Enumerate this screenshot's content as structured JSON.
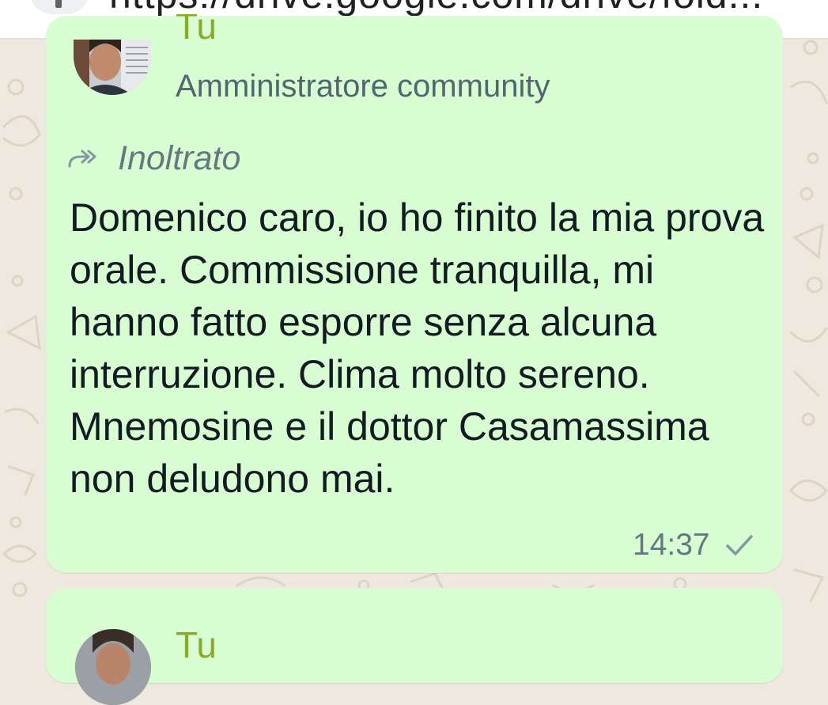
{
  "top_bar": {
    "url_text": "https://drive.google.com/drive/fold..."
  },
  "message": {
    "sender": "Tu",
    "role": "Amministratore community",
    "forwarded_label": "Inoltrato",
    "text": "Domenico caro, io ho finito la mia prova orale. Commissione tranquilla, mi hanno fatto esporre senza alcuna interruzione. Clima molto sereno. Mnemosine e il dottor Casamassima non deludono mai.",
    "time": "14:37",
    "status_icon": "single-check-icon"
  },
  "next_message": {
    "sender": "Tu"
  },
  "colors": {
    "bubble": "#d9fdd3",
    "background": "#efe8de",
    "sender": "#8aab2a",
    "meta_text": "#667781",
    "body_text": "#111b21"
  }
}
